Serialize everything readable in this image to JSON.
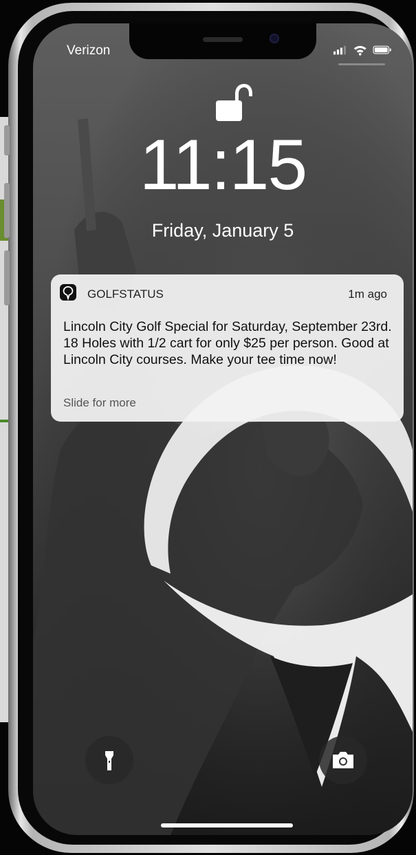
{
  "status_bar": {
    "carrier": "Verizon"
  },
  "lock_screen": {
    "time": "11:15",
    "date": "Friday, January 5"
  },
  "notification": {
    "app_name": "GOLFSTATUS",
    "time_ago": "1m ago",
    "message": "Lincoln City Golf Special for Saturday, September 23rd. 18 Holes with 1/2 cart for only $25 per person. Good at Lincoln City courses. Make your tee time now!",
    "hint": "Slide for more"
  },
  "quick_actions": {
    "left_icon": "flashlight-icon",
    "right_icon": "camera-icon"
  },
  "colors": {
    "notification_bg": "#f2f2f2",
    "screen_text": "#ffffff"
  }
}
